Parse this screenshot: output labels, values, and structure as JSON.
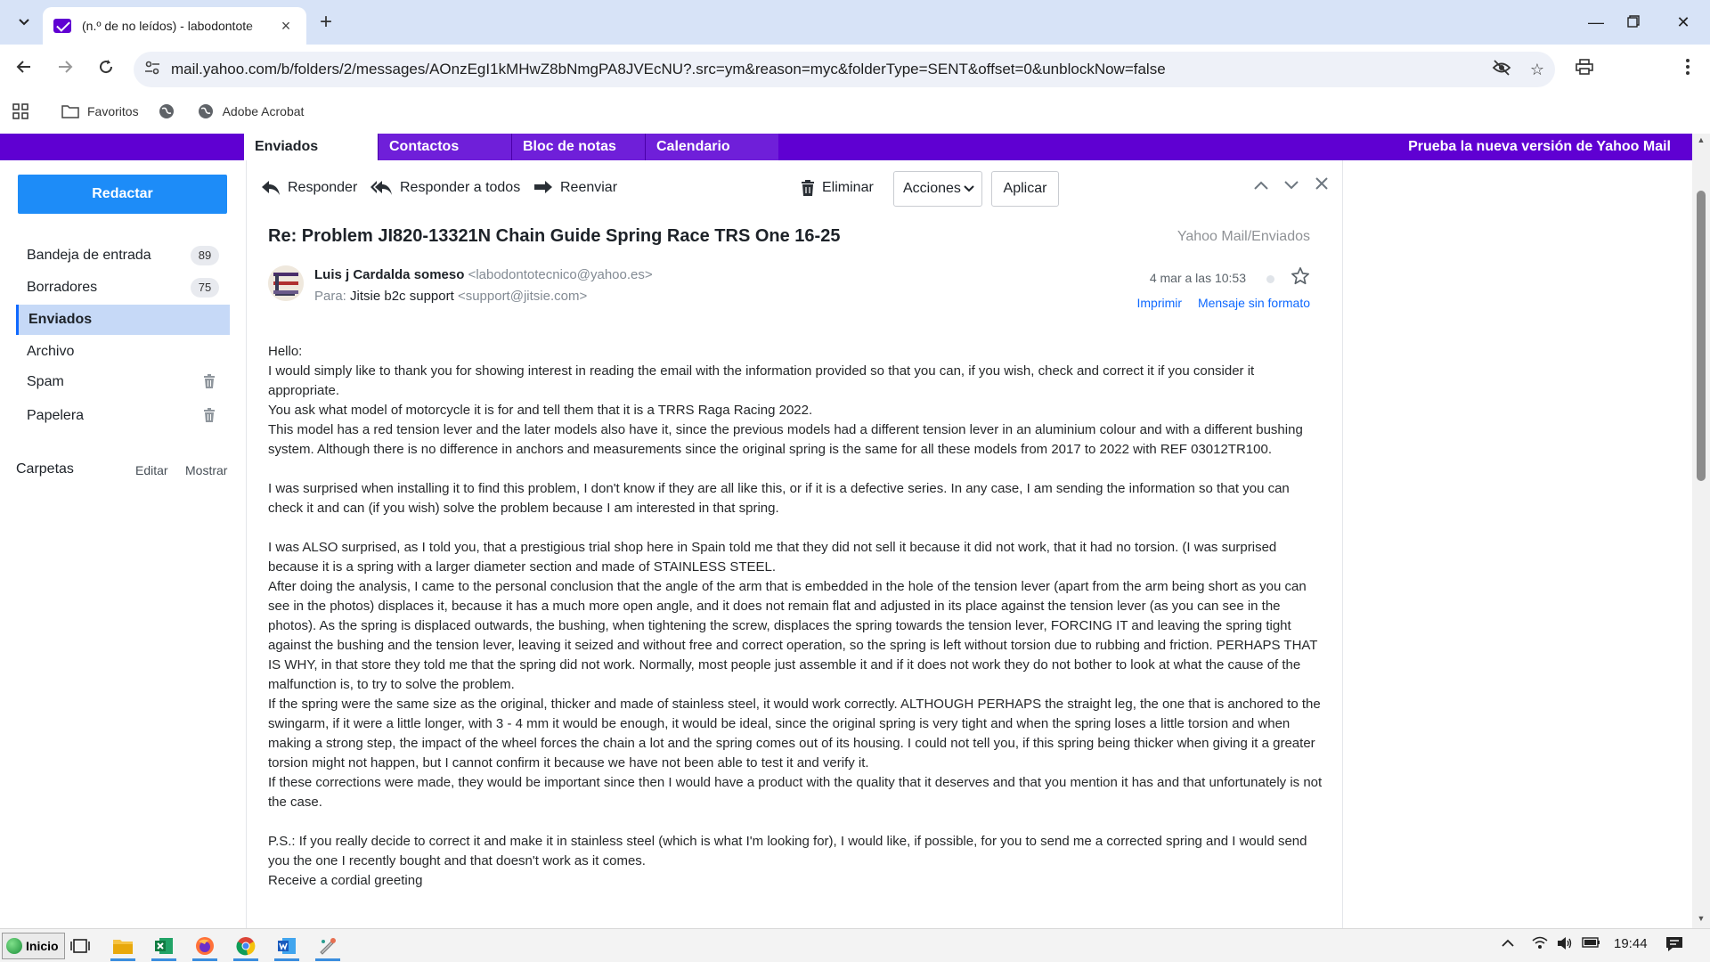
{
  "browser": {
    "tab_title": "(n.º de no leídos) - labodontote",
    "url": "mail.yahoo.com/b/folders/2/messages/AOnzEgI1kMHwZ8bNmgPA8JVEcNU?.src=ym&reason=myc&folderType=SENT&offset=0&unblockNow=false",
    "bookmarks": [
      "Favoritos",
      "Adobe Acrobat"
    ]
  },
  "mail": {
    "tabs": [
      "Enviados",
      "Contactos",
      "Bloc de notas",
      "Calendario"
    ],
    "promo": "Prueba la nueva versión de Yahoo Mail",
    "compose": "Redactar",
    "folders": [
      {
        "label": "Bandeja de entrada",
        "count": "89"
      },
      {
        "label": "Borradores",
        "count": "75"
      },
      {
        "label": "Enviados",
        "count": ""
      },
      {
        "label": "Archivo",
        "count": ""
      },
      {
        "label": "Spam",
        "count": ""
      },
      {
        "label": "Papelera",
        "count": ""
      }
    ],
    "carpetas": {
      "label": "Carpetas",
      "edit": "Editar",
      "show": "Mostrar"
    },
    "toolbar": {
      "reply": "Responder",
      "reply_all": "Responder a todos",
      "forward": "Reenviar",
      "delete": "Eliminar",
      "actions": "Acciones",
      "apply": "Aplicar"
    },
    "message": {
      "subject": "Re: Problem JI820-13321N Chain Guide Spring Race TRS One 16-25",
      "location": "Yahoo Mail/Enviados",
      "from_name": "Luis j Cardalda someso",
      "from_email": "<labodontotecnico@yahoo.es>",
      "to_label": "Para:",
      "to_name": "Jitsie b2c support",
      "to_email": "<support@jitsie.com>",
      "date": "4 mar a las 10:53",
      "print": "Imprimir",
      "raw": "Mensaje sin formato",
      "paragraphs": [
        "Hello:",
        "I would simply like to thank you for showing interest in reading the email with the information provided so that you can, if you wish, check and correct it if you consider it appropriate.",
        "You ask what model of motorcycle it is for and tell them that it is a TRRS Raga Racing 2022.",
        "This model has a red tension lever and the later models also have it, since the previous models had a different tension lever in an aluminium colour and with a different bushing system. Although there is no difference in anchors and measurements since the original spring is the same for all these models from 2017 to 2022 with REF 03012TR100.",
        "",
        "I was surprised when installing it to find this problem, I don't know if they are all like this, or if it is a defective series. In any case, I am sending the information so that you can check it and can (if you wish) solve the problem because I am interested in that spring.",
        "",
        "I was ALSO surprised, as I told you, that a prestigious trial shop here in Spain told me that they did not sell it because it did not work, that it had no torsion. (I was surprised because it is a spring with a larger diameter section and made of STAINLESS STEEL.",
        "After doing the analysis, I came to the personal conclusion that the angle of the arm that is embedded in the hole of the tension lever (apart from the arm being short as you can see in the photos) displaces it, because it has a much more open angle, and it does not remain flat and adjusted in its place against the tension lever (as you can see in the photos). As the spring is displaced outwards, the bushing, when tightening the screw, displaces the spring towards the tension lever, FORCING IT and leaving the spring tight against the bushing and the tension lever, leaving it seized and without free and correct operation, so the spring is left without torsion due to rubbing and friction. PERHAPS THAT IS WHY, in that store they told me that the spring did not work. Normally, most people just assemble it and if it does not work they do not bother to look at what the cause of the malfunction is, to try to solve the problem.",
        "If the spring were the same size as the original, thicker and made of stainless steel, it would work correctly. ALTHOUGH PERHAPS the straight leg, the one that is anchored to the swingarm, if it were a little longer, with 3 - 4 mm it would be enough, it would be ideal, since the original spring is very tight and when the spring loses a little torsion and when making a strong step, the impact of the wheel forces the chain a lot and the spring comes out of its housing. I could not tell you, if this spring being thicker when giving it a greater torsion might not happen, but I cannot confirm it because we have not been able to test it and verify it.",
        "If these corrections were made, they would be important since then I would have a product with the quality that it deserves and that you mention it has and that unfortunately is not the case.",
        "",
        "P.S.: If you really decide to correct it and make it in stainless steel (which is what I'm looking for), I would like, if possible, for you to send me a corrected spring and I would send you the one I recently bought and that doesn't work as it comes.",
        "Receive a cordial greeting"
      ]
    }
  },
  "taskbar": {
    "start": "Inicio",
    "time": "19:44"
  },
  "colors": {
    "nav_purple": "#5f00d2",
    "accent_blue": "#1d8cf8",
    "selected_folder": "#c6d9f7",
    "link_blue": "#0f69ff"
  }
}
